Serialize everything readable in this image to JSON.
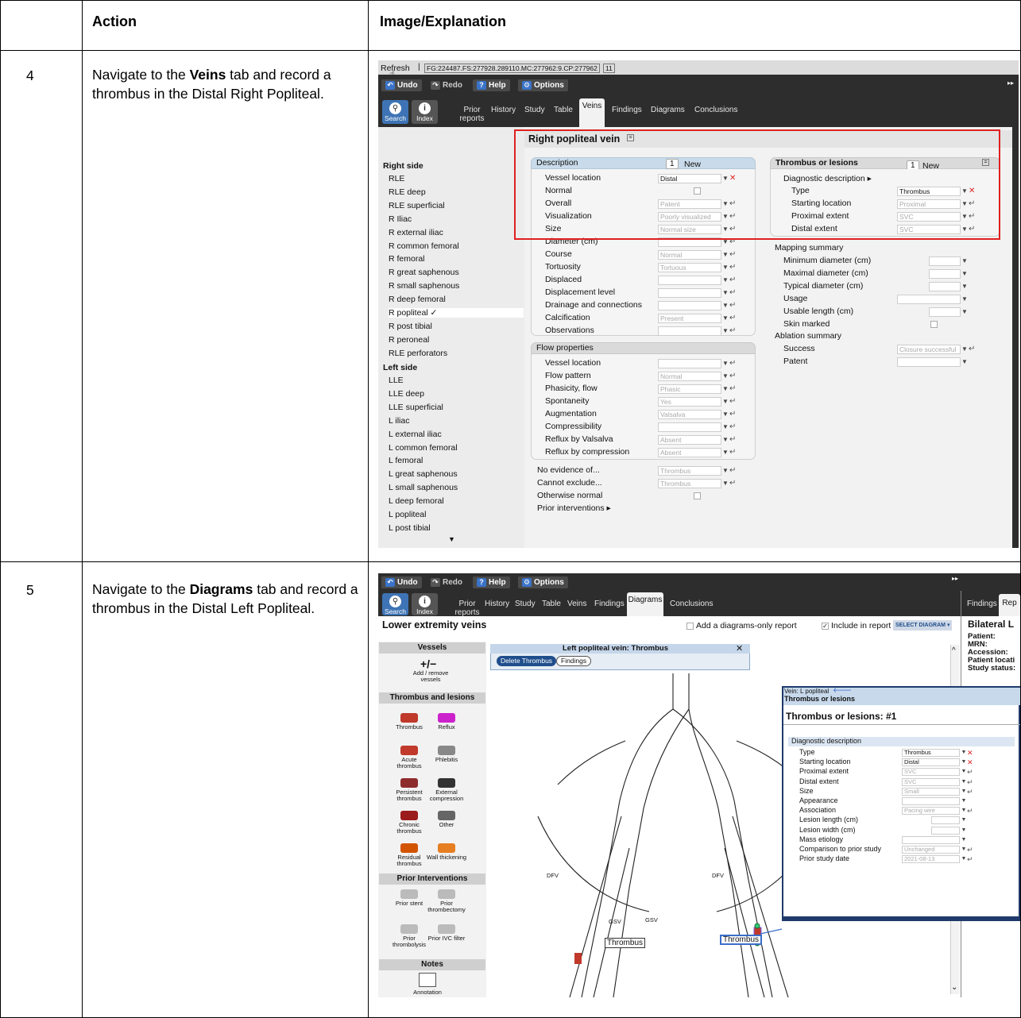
{
  "table": {
    "headers": {
      "action": "Action",
      "image": "Image/Explanation"
    },
    "rows": [
      {
        "num": "4",
        "text_pre": "Navigate to the ",
        "bold": "Veins",
        "text_post": " tab and record a thrombus in the  Distal Right Popliteal."
      },
      {
        "num": "5",
        "text_pre": "Navigate to the ",
        "bold": "Diagrams",
        "text_post": " tab and record a thrombus in the Distal Left Popliteal."
      }
    ]
  },
  "shot1": {
    "refresh": "Refresh",
    "id_string": "FG:224487.FS:277928.289110.MC:277962:9.CP:277962",
    "id_num": "11",
    "toolbar": {
      "undo": "Undo",
      "redo": "Redo",
      "help": "Help",
      "options": "Options"
    },
    "buttons": {
      "search": "Search",
      "index": "Index"
    },
    "tabs": [
      "Prior reports",
      "History",
      "Study",
      "Table",
      "Veins",
      "Findings",
      "Diagrams",
      "Conclusions"
    ],
    "section_title": "Right popliteal vein",
    "sidebar": {
      "right_header": "Right side",
      "right_items": [
        "RLE",
        "RLE deep",
        "RLE superficial",
        "R Iliac",
        "R external iliac",
        "R common femoral",
        "R femoral",
        "R great saphenous",
        "R small saphenous",
        "R deep femoral",
        "R popliteal ✓",
        "R post tibial",
        "R peroneal",
        "RLE perforators"
      ],
      "left_header": "Left side",
      "left_items": [
        "LLE",
        "LLE deep",
        "LLE superficial",
        "L iliac",
        "L external iliac",
        "L common femoral",
        "L femoral",
        "L great saphenous",
        "L small saphenous",
        "L deep femoral",
        "L popliteal",
        "L post tibial"
      ]
    },
    "description": {
      "header": "Description",
      "count": "1",
      "new": "New",
      "rows": [
        {
          "label": "Vessel location",
          "value": "Distal",
          "dark": true
        },
        {
          "label": "Normal",
          "value": "",
          "check": true
        },
        {
          "label": "Overall",
          "value": "Patent"
        },
        {
          "label": "Visualization",
          "value": "Poorly visualized"
        },
        {
          "label": "Size",
          "value": "Normal size"
        },
        {
          "label": "Diameter (cm)",
          "value": ""
        },
        {
          "label": "Course",
          "value": "Normal"
        },
        {
          "label": "Tortuosity",
          "value": "Tortuous"
        },
        {
          "label": "Displaced",
          "value": ""
        },
        {
          "label": "Displacement level",
          "value": ""
        },
        {
          "label": "Drainage and connections",
          "value": ""
        },
        {
          "label": "Calcification",
          "value": "Present"
        },
        {
          "label": "Observations",
          "value": ""
        }
      ]
    },
    "flow": {
      "header": "Flow properties",
      "rows": [
        {
          "label": "Vessel location",
          "value": ""
        },
        {
          "label": "Flow pattern",
          "value": "Normal"
        },
        {
          "label": "Phasicity, flow",
          "value": "Phasic"
        },
        {
          "label": "Spontaneity",
          "value": "Yes"
        },
        {
          "label": "Augmentation",
          "value": "Valsalva"
        },
        {
          "label": "Compressibility",
          "value": ""
        },
        {
          "label": "Reflux by Valsalva",
          "value": "Absent"
        },
        {
          "label": "Reflux by compression",
          "value": "Absent"
        }
      ]
    },
    "misc": [
      {
        "label": "No evidence of...",
        "value": "Thrombus"
      },
      {
        "label": "Cannot exclude...",
        "value": "Thrombus"
      },
      {
        "label": "Otherwise normal",
        "value": ""
      },
      {
        "label": "Prior interventions ▸",
        "value": ""
      }
    ],
    "thrombus": {
      "header": "Thrombus or lesions",
      "count": "1",
      "new": "New",
      "diag": "Diagnostic description ▸",
      "rows": [
        {
          "label": "Type",
          "value": "Thrombus",
          "dark": true
        },
        {
          "label": "Starting location",
          "value": "Proximal"
        },
        {
          "label": "Proximal extent",
          "value": "SVC"
        },
        {
          "label": "Distal extent",
          "value": "SVC"
        }
      ]
    },
    "mapping": {
      "header": "Mapping summary",
      "rows": [
        "Minimum diameter (cm)",
        "Maximal diameter (cm)",
        "Typical diameter (cm)",
        "Usage",
        "Usable length (cm)",
        "Skin marked"
      ]
    },
    "ablation": {
      "header": "Ablation summary",
      "rows": [
        {
          "label": "Success",
          "value": "Closure successful"
        },
        {
          "label": "Patent",
          "value": ""
        }
      ]
    }
  },
  "shot2": {
    "toolbar": {
      "undo": "Undo",
      "redo": "Redo",
      "help": "Help",
      "options": "Options"
    },
    "buttons": {
      "search": "Search",
      "index": "Index"
    },
    "tabs": [
      "Prior reports",
      "History",
      "Study",
      "Table",
      "Veins",
      "Findings",
      "Diagrams",
      "Conclusions"
    ],
    "right_tabs": [
      "Findings",
      "Rep"
    ],
    "title": "Lower extremity veins",
    "diagrams_only": "Add a diagrams-only report",
    "include": "Include in report",
    "select_diagram": "SELECT DIAGRAM ▾",
    "bilateral": "Bilateral L",
    "patient_fields": [
      "Patient:",
      "MRN:",
      "Accession:",
      "Patient locati",
      "Study status:"
    ],
    "palette": {
      "vessels": "Vessels",
      "add_remove": "+/−",
      "add_remove_lbl": "Add / remove vessels",
      "thrombus_hdr": "Thrombus and lesions",
      "items": [
        "Thrombus",
        "Reflux",
        "Acute thrombus",
        "Phlebitis",
        "Persistent thrombus",
        "External compression",
        "Chronic thrombus",
        "Other",
        "Residual thrombus",
        "Wall thickening"
      ],
      "prior_hdr": "Prior Interventions",
      "prior_items": [
        "Prior stent",
        "Prior thrombectomy",
        "Prior thrombolysis",
        "Prior IVC filter"
      ],
      "notes_hdr": "Notes",
      "annotation": "Annotation"
    },
    "popup": {
      "title": "Left popliteal vein: Thrombus",
      "delete": "Delete Thrombus",
      "findings": "Findings"
    },
    "diagram_labels": {
      "dfv": "DFV",
      "gsv": "GSV",
      "thrombus": "Thrombus"
    },
    "side_panel": {
      "vein": "Vein: L popliteal",
      "section": "Thrombus or lesions",
      "heading": "Thrombus or lesions: #1",
      "diag": "Diagnostic description",
      "rows": [
        {
          "label": "Type",
          "value": "Thrombus",
          "dark": true,
          "x": true
        },
        {
          "label": "Starting location",
          "value": "Distal",
          "dark": true,
          "x": true
        },
        {
          "label": "Proximal extent",
          "value": "SVC"
        },
        {
          "label": "Distal extent",
          "value": "SVC"
        },
        {
          "label": "Size",
          "value": "Small"
        },
        {
          "label": "Appearance",
          "value": ""
        },
        {
          "label": "Association",
          "value": "Pacing wire"
        },
        {
          "label": "Lesion length (cm)",
          "value": ""
        },
        {
          "label": "Lesion width (cm)",
          "value": ""
        },
        {
          "label": "Mass etiology",
          "value": ""
        },
        {
          "label": "Comparison to prior study",
          "value": "Unchanged"
        },
        {
          "label": "Prior study date",
          "value": "2021-08-13"
        }
      ]
    }
  },
  "colors": {
    "thrombus": "#c0392b",
    "reflux": "#cc22cc",
    "active_blue": "#1f4e8c",
    "highlight": "#e02020"
  }
}
